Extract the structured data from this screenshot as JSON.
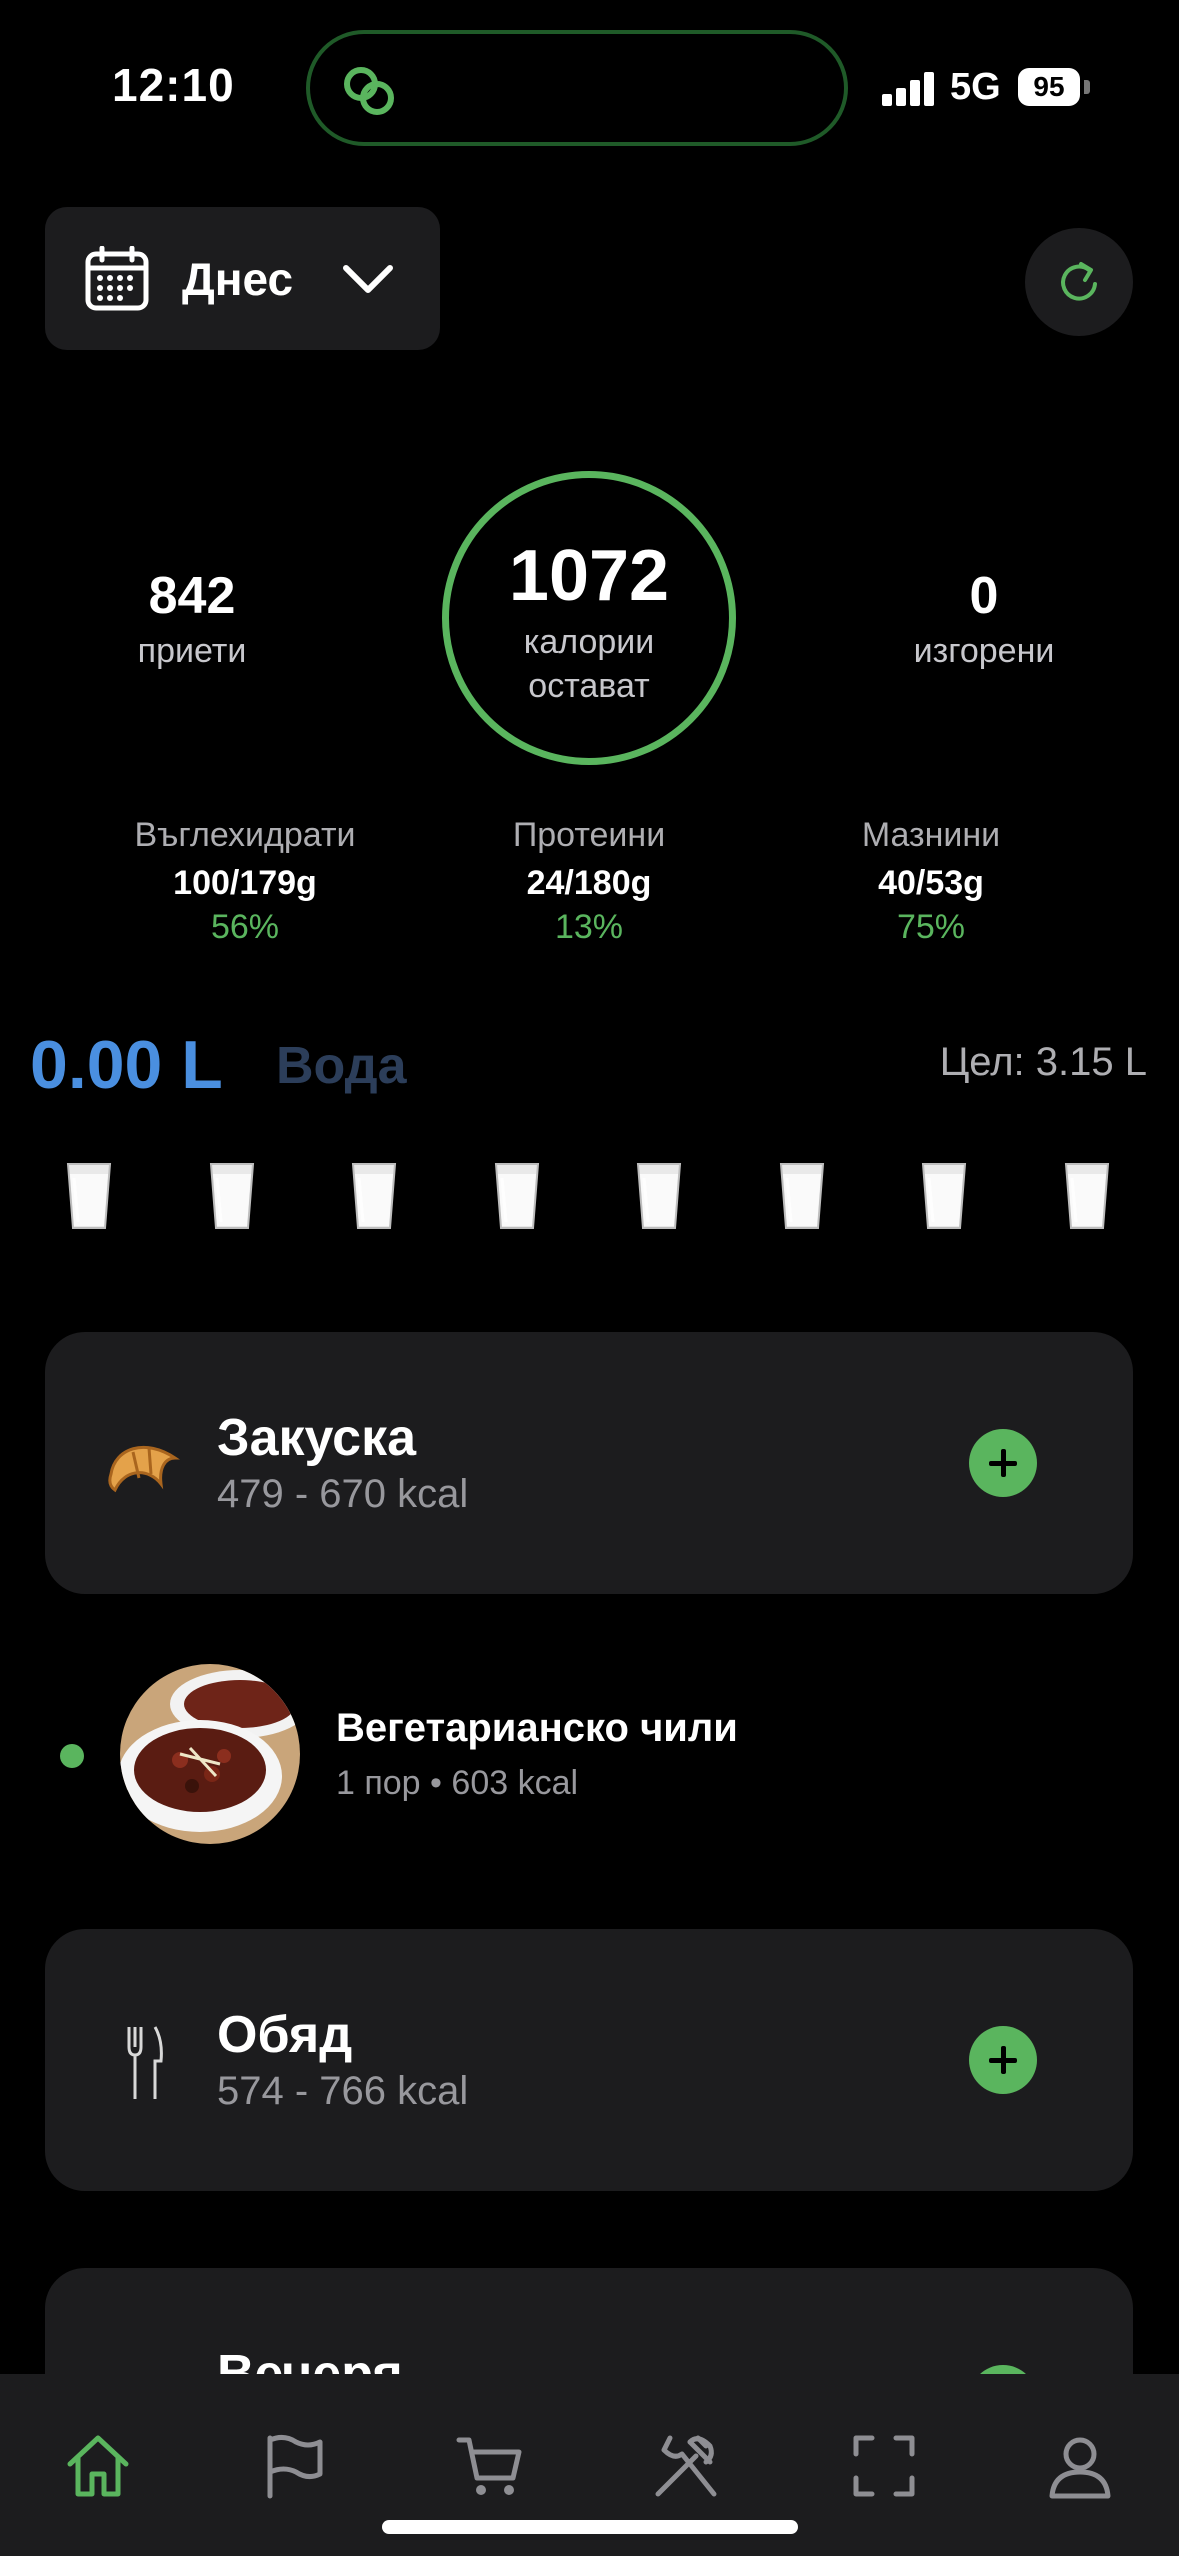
{
  "status_bar": {
    "time": "12:10",
    "network": "5G",
    "battery": "95"
  },
  "header": {
    "date_label": "Днес"
  },
  "summary": {
    "eaten_value": "842",
    "eaten_label": "приети",
    "remaining_value": "1072",
    "remaining_label_1": "калории",
    "remaining_label_2": "остават",
    "burned_value": "0",
    "burned_label": "изгорени"
  },
  "macros": [
    {
      "name": "Въглехидрати",
      "value": "100/179g",
      "percent": "56%"
    },
    {
      "name": "Протеини",
      "value": "24/180g",
      "percent": "13%"
    },
    {
      "name": "Мазнини",
      "value": "40/53g",
      "percent": "75%"
    }
  ],
  "water": {
    "amount": "0.00 L",
    "label": "Вода",
    "goal": "Цел: 3.15 L",
    "glasses": 8
  },
  "meals": [
    {
      "title": "Закуска",
      "range": "479 - 670 kcal",
      "icon": "croissant-icon"
    },
    {
      "title": "Обяд",
      "range": "574 - 766 kcal",
      "icon": "fork-knife-icon"
    },
    {
      "title": "Вечеря",
      "range": "",
      "icon": "fork-knife-icon"
    }
  ],
  "logged_food": {
    "title": "Вегетарианско чили",
    "portion": "1 пор",
    "calories": "603 kcal"
  },
  "tabs": [
    "home-icon",
    "flag-icon",
    "cart-icon",
    "utensils-icon",
    "scan-icon",
    "profile-icon"
  ],
  "colors": {
    "accent": "#5ab55e",
    "water": "#4a8fe0",
    "card": "#1c1c1e"
  }
}
